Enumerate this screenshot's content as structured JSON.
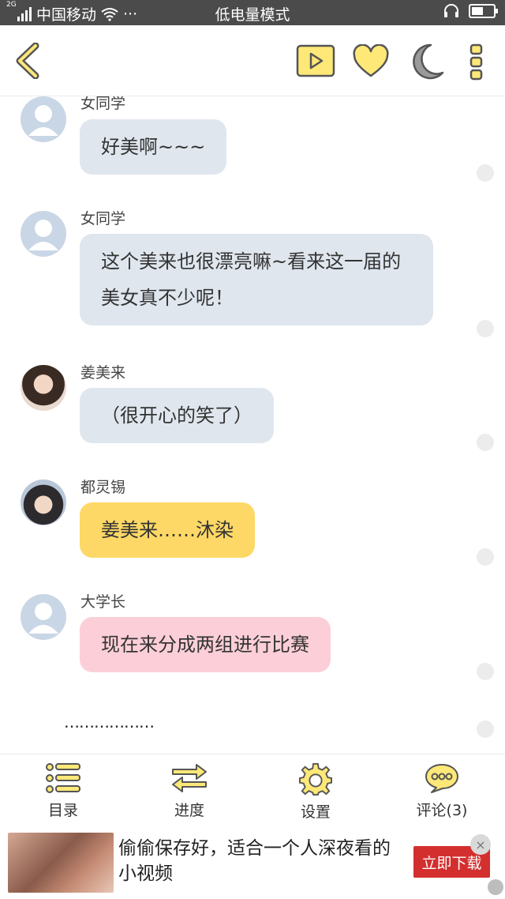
{
  "status_bar": {
    "network": "2G",
    "carrier": "中国移动",
    "dots": "···",
    "mode": "低电量模式",
    "icons": [
      "signal-icon",
      "wifi-icon",
      "headset-icon",
      "battery-icon"
    ]
  },
  "toolbar": {
    "icons": [
      "back-icon",
      "play-icon",
      "heart-icon",
      "moon-icon",
      "more-icon"
    ],
    "colors": {
      "accent": "#fde878",
      "outline": "#555555",
      "moon": "#9a9a9a"
    }
  },
  "chat": {
    "messages": [
      {
        "sender": "女同学",
        "text": "好美啊~~~",
        "color": "grey",
        "avatar": "default-avatar"
      },
      {
        "sender": "女同学",
        "text": "这个美来也很漂亮嘛~看来这一届的美女真不少呢！",
        "color": "grey",
        "avatar": "default-avatar"
      },
      {
        "sender": "姜美来",
        "text": "（很开心的笑了）",
        "color": "grey",
        "avatar": "girl-avatar"
      },
      {
        "sender": "都灵锡",
        "text": "姜美来……沐染",
        "color": "yellow",
        "avatar": "boy-avatar"
      },
      {
        "sender": "大学长",
        "text": "现在来分成两组进行比赛",
        "color": "pink",
        "avatar": "default-avatar"
      }
    ],
    "trailing_text": "………………"
  },
  "bottom_nav": {
    "items": [
      {
        "label": "目录",
        "icon": "list-icon"
      },
      {
        "label": "进度",
        "icon": "swap-arrows-icon"
      },
      {
        "label": "设置",
        "icon": "gear-icon"
      },
      {
        "label": "评论(3)",
        "icon": "comment-icon"
      }
    ]
  },
  "ad": {
    "text": "偷偷保存好，适合一个人深夜看的小视频",
    "button": "立即下载",
    "close": "×"
  }
}
